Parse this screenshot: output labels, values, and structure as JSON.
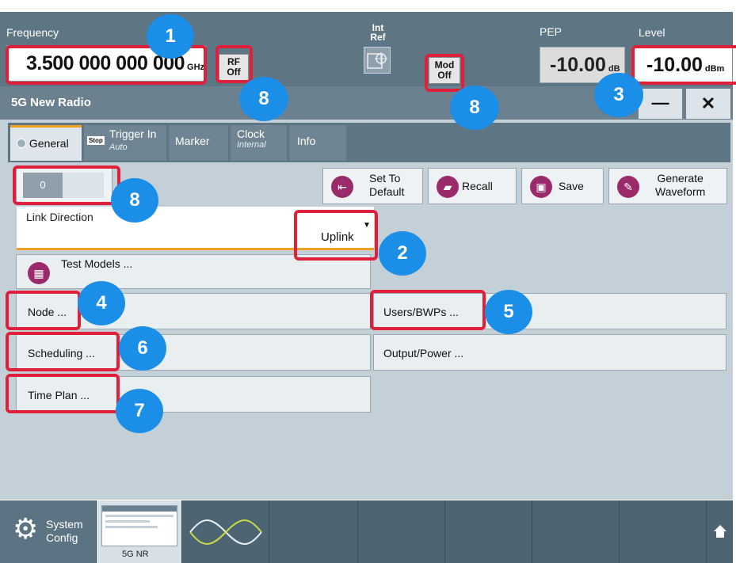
{
  "status_bar": {
    "frequency_label": "Frequency",
    "frequency_value": "3.500 000 000 000",
    "frequency_unit": "GHz",
    "rf_button": [
      "RF",
      "Off"
    ],
    "int_ref": [
      "Int",
      "Ref"
    ],
    "mod_button": [
      "Mod",
      "Off"
    ],
    "pep_label": "PEP",
    "pep_value": "-10.00",
    "pep_unit": "dB",
    "level_label": "Level",
    "level_value": "-10.00",
    "level_unit": "dBm"
  },
  "dialog": {
    "title": "5G New Radio",
    "minimize": "—",
    "close": "✕",
    "tabs": [
      {
        "label": "General",
        "sub": ""
      },
      {
        "label": "Trigger In",
        "sub": "Auto",
        "badge": "Stop"
      },
      {
        "label": "Marker",
        "sub": ""
      },
      {
        "label": "Clock",
        "sub": "Internal"
      },
      {
        "label": "Info",
        "sub": ""
      }
    ],
    "toggle_state": "0",
    "actions": {
      "set_default": [
        "Set To",
        "Default"
      ],
      "recall": "Recall",
      "save": "Save",
      "generate": [
        "Generate",
        "Waveform"
      ]
    },
    "link_direction_label": "Link Direction",
    "link_direction_value": "Uplink",
    "buttons": {
      "test_models": "Test Models ...",
      "node": "Node ...",
      "users_bwps": "Users/BWPs ...",
      "scheduling": "Scheduling ...",
      "output_power": "Output/Power ...",
      "time_plan": "Time Plan ..."
    }
  },
  "callouts": [
    "1",
    "2",
    "3",
    "4",
    "5",
    "6",
    "7",
    "8"
  ],
  "taskbar": {
    "system_config": [
      "System",
      "Config"
    ],
    "thumb_label": "5G NR"
  },
  "colors": {
    "accent_red": "#e0203a",
    "callout_blue": "#1b8ee8",
    "status_bar": "#5e7584",
    "dialog_bg": "#c4d0d8",
    "icon_magenta": "#9a2a6a"
  }
}
